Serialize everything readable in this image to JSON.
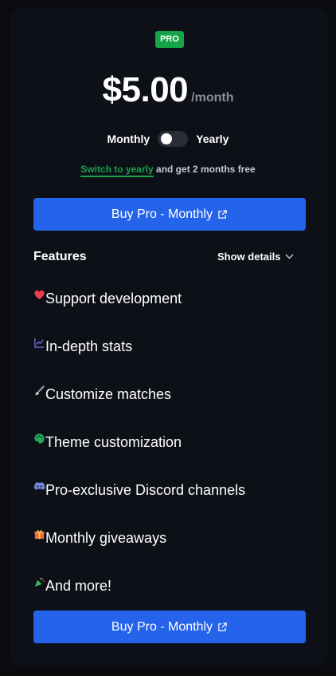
{
  "badge": "PRO",
  "price": {
    "amount": "$5.00",
    "period": "/month"
  },
  "billing_toggle": {
    "left_label": "Monthly",
    "right_label": "Yearly",
    "selected": "Monthly"
  },
  "promo": {
    "link_text": "Switch to yearly",
    "rest_text": "and get 2 months free"
  },
  "buy_button": {
    "label": "Buy Pro - Monthly",
    "icon": "external-link-icon"
  },
  "features": {
    "title": "Features",
    "show_details": "Show details",
    "items": [
      {
        "label": "Support development",
        "icon": "heart-icon"
      },
      {
        "label": "In-depth stats",
        "icon": "chart-icon"
      },
      {
        "label": "Customize matches",
        "icon": "brush-icon"
      },
      {
        "label": "Theme customization",
        "icon": "palette-icon"
      },
      {
        "label": "Pro-exclusive Discord channels",
        "icon": "discord-icon"
      },
      {
        "label": "Monthly giveaways",
        "icon": "gift-icon"
      },
      {
        "label": "And more!",
        "icon": "party-popper-icon"
      }
    ]
  },
  "colors": {
    "background": "#0a0b0f",
    "card": "#0e1018",
    "badge": "#16a34a",
    "primary_button": "#2563eb",
    "promo_link": "#16a34a"
  }
}
